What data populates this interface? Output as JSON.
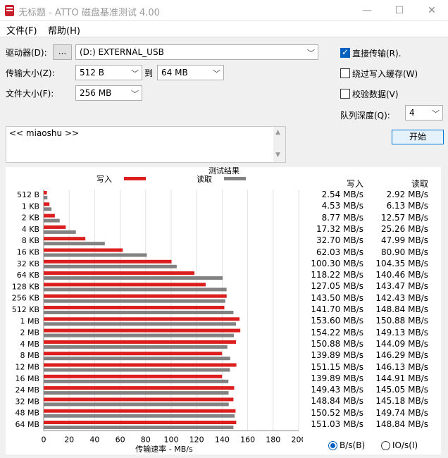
{
  "window": {
    "title": "无标题 - ATTO 磁盘基准测试 4.00",
    "minimize": "—",
    "maximize": "☐",
    "close": "✕"
  },
  "menu": {
    "file": "文件(F)",
    "help": "帮助(H)"
  },
  "settings": {
    "drive_label": "驱动器(D):",
    "drive_browse": "...",
    "drive_value": "(D:) EXTERNAL_USB",
    "transfer_label": "传输大小(Z):",
    "transfer_from": "512 B",
    "transfer_to_label": "到",
    "transfer_to": "64 MB",
    "file_size_label": "文件大小(F):",
    "file_size": "256 MB",
    "direct_io_label": "直接传输(R).",
    "direct_io_checked": true,
    "bypass_write_cache_label": "绕过写入缓存(W)",
    "bypass_write_cache_checked": false,
    "verify_data_label": "校验数据(V)",
    "verify_data_checked": false,
    "queue_depth_label": "队列深度(Q):",
    "queue_depth": "4",
    "start_button": "开始"
  },
  "notes": {
    "text": "<< miaoshu >>"
  },
  "chart_data": {
    "type": "bar",
    "title": "测试结果",
    "xlabel": "传输速率 - MB/s",
    "ylabel": "",
    "xlim": [
      0,
      200
    ],
    "xticks": [
      0,
      20,
      40,
      60,
      80,
      100,
      120,
      140,
      160,
      180,
      200
    ],
    "categories": [
      "512 B",
      "1 KB",
      "2 KB",
      "4 KB",
      "8 KB",
      "16 KB",
      "32 KB",
      "64 KB",
      "128 KB",
      "256 KB",
      "512 KB",
      "1 MB",
      "2 MB",
      "4 MB",
      "8 MB",
      "12 MB",
      "16 MB",
      "24 MB",
      "32 MB",
      "48 MB",
      "64 MB"
    ],
    "series": [
      {
        "name": "写入",
        "color": "#dc1e1e",
        "values": [
          2.54,
          4.53,
          8.77,
          17.32,
          32.7,
          62.03,
          100.3,
          118.22,
          127.05,
          143.5,
          141.7,
          153.6,
          154.22,
          150.88,
          139.89,
          151.15,
          139.89,
          149.43,
          148.84,
          150.52,
          151.03
        ]
      },
      {
        "name": "读取",
        "color": "#828282",
        "values": [
          2.92,
          6.13,
          12.57,
          25.26,
          47.99,
          80.9,
          104.35,
          140.46,
          143.47,
          142.43,
          148.84,
          150.88,
          149.13,
          144.09,
          146.29,
          146.13,
          144.91,
          145.05,
          145.18,
          149.74,
          148.84
        ]
      }
    ],
    "legend": "top"
  },
  "results": {
    "write_header": "写入",
    "read_header": "读取",
    "rows": [
      {
        "write": "2.54 MB/s",
        "read": "2.92 MB/s"
      },
      {
        "write": "4.53 MB/s",
        "read": "6.13 MB/s"
      },
      {
        "write": "8.77 MB/s",
        "read": "12.57 MB/s"
      },
      {
        "write": "17.32 MB/s",
        "read": "25.26 MB/s"
      },
      {
        "write": "32.70 MB/s",
        "read": "47.99 MB/s"
      },
      {
        "write": "62.03 MB/s",
        "read": "80.90 MB/s"
      },
      {
        "write": "100.30 MB/s",
        "read": "104.35 MB/s"
      },
      {
        "write": "118.22 MB/s",
        "read": "140.46 MB/s"
      },
      {
        "write": "127.05 MB/s",
        "read": "143.47 MB/s"
      },
      {
        "write": "143.50 MB/s",
        "read": "142.43 MB/s"
      },
      {
        "write": "141.70 MB/s",
        "read": "148.84 MB/s"
      },
      {
        "write": "153.60 MB/s",
        "read": "150.88 MB/s"
      },
      {
        "write": "154.22 MB/s",
        "read": "149.13 MB/s"
      },
      {
        "write": "150.88 MB/s",
        "read": "144.09 MB/s"
      },
      {
        "write": "139.89 MB/s",
        "read": "146.29 MB/s"
      },
      {
        "write": "151.15 MB/s",
        "read": "146.13 MB/s"
      },
      {
        "write": "139.89 MB/s",
        "read": "144.91 MB/s"
      },
      {
        "write": "149.43 MB/s",
        "read": "145.05 MB/s"
      },
      {
        "write": "148.84 MB/s",
        "read": "145.18 MB/s"
      },
      {
        "write": "150.52 MB/s",
        "read": "149.74 MB/s"
      },
      {
        "write": "151.03 MB/s",
        "read": "148.84 MB/s"
      }
    ]
  },
  "units": {
    "bytes_label": "B/s(B)",
    "bytes_selected": true,
    "io_label": "IO/s(I)",
    "io_selected": false
  },
  "colors": {
    "write": "#dc1e1e",
    "read": "#828282",
    "accent": "#0060c0"
  }
}
